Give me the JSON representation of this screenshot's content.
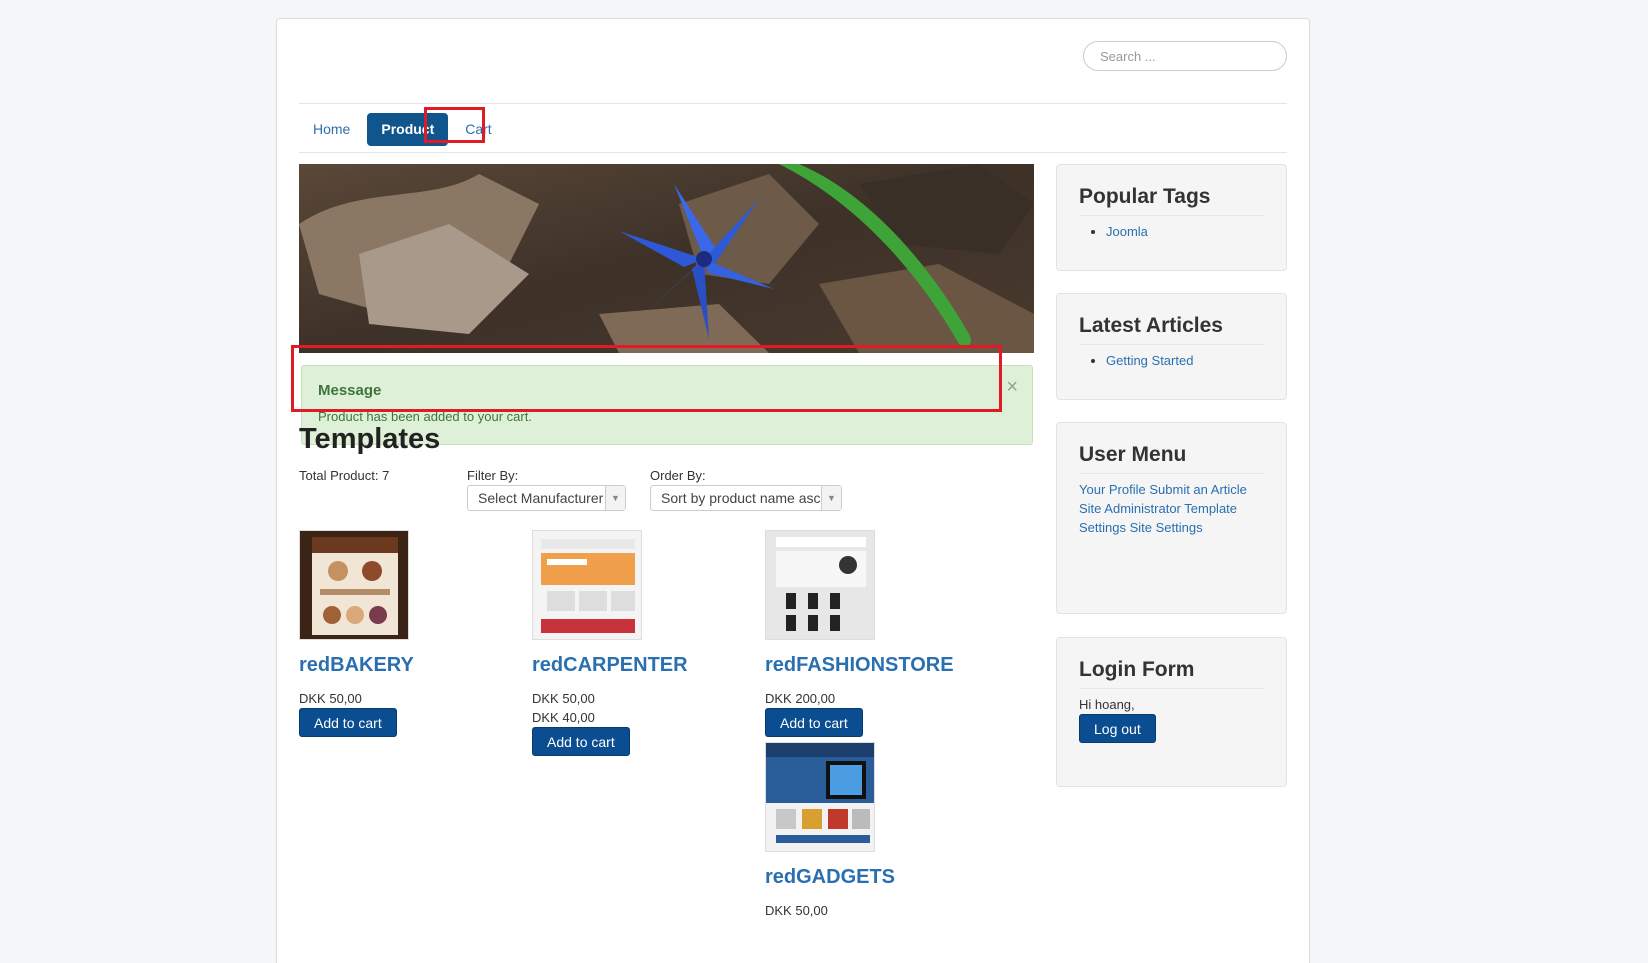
{
  "search": {
    "placeholder": "Search ..."
  },
  "nav": {
    "items": [
      {
        "label": "Home"
      },
      {
        "label": "Product"
      },
      {
        "label": "Cart"
      }
    ]
  },
  "alert": {
    "title": "Message",
    "message": "Product has been added to your cart.",
    "close": "×"
  },
  "main": {
    "heading": "Templates",
    "total": "Total Product: 7",
    "filter_label": "Filter By:",
    "filter_value": "Select Manufacturer",
    "order_label": "Order By:",
    "order_value": "Sort by product name asc",
    "add_to_cart": "Add to cart",
    "products": [
      {
        "name": "redBAKERY",
        "prices": [
          "DKK 50,00"
        ]
      },
      {
        "name": "redCARPENTER",
        "prices": [
          "DKK 50,00",
          "DKK 40,00"
        ]
      },
      {
        "name": "redFASHIONSTORE",
        "prices": [
          "DKK 200,00"
        ]
      },
      {
        "name": "redGADGETS",
        "prices": [
          "DKK 50,00"
        ]
      }
    ]
  },
  "sidebar": {
    "popular_tags": {
      "title": "Popular Tags",
      "items": [
        "Joomla"
      ]
    },
    "latest_articles": {
      "title": "Latest Articles",
      "items": [
        "Getting Started"
      ]
    },
    "user_menu": {
      "title": "User Menu",
      "items": [
        "Your Profile",
        "Submit an Article",
        "Site Administrator",
        "Template Settings",
        "Site Settings"
      ]
    },
    "login": {
      "title": "Login Form",
      "greeting": "Hi hoang,",
      "logout": "Log out"
    }
  },
  "colors": {
    "accent": "#10558c",
    "button": "#0a4d90",
    "link": "#2a6fb0",
    "highlight": "#e01b25",
    "alert_bg": "#dff0d8"
  },
  "icons": {
    "close": "close-icon",
    "dropdown": "chevron-down-icon"
  }
}
